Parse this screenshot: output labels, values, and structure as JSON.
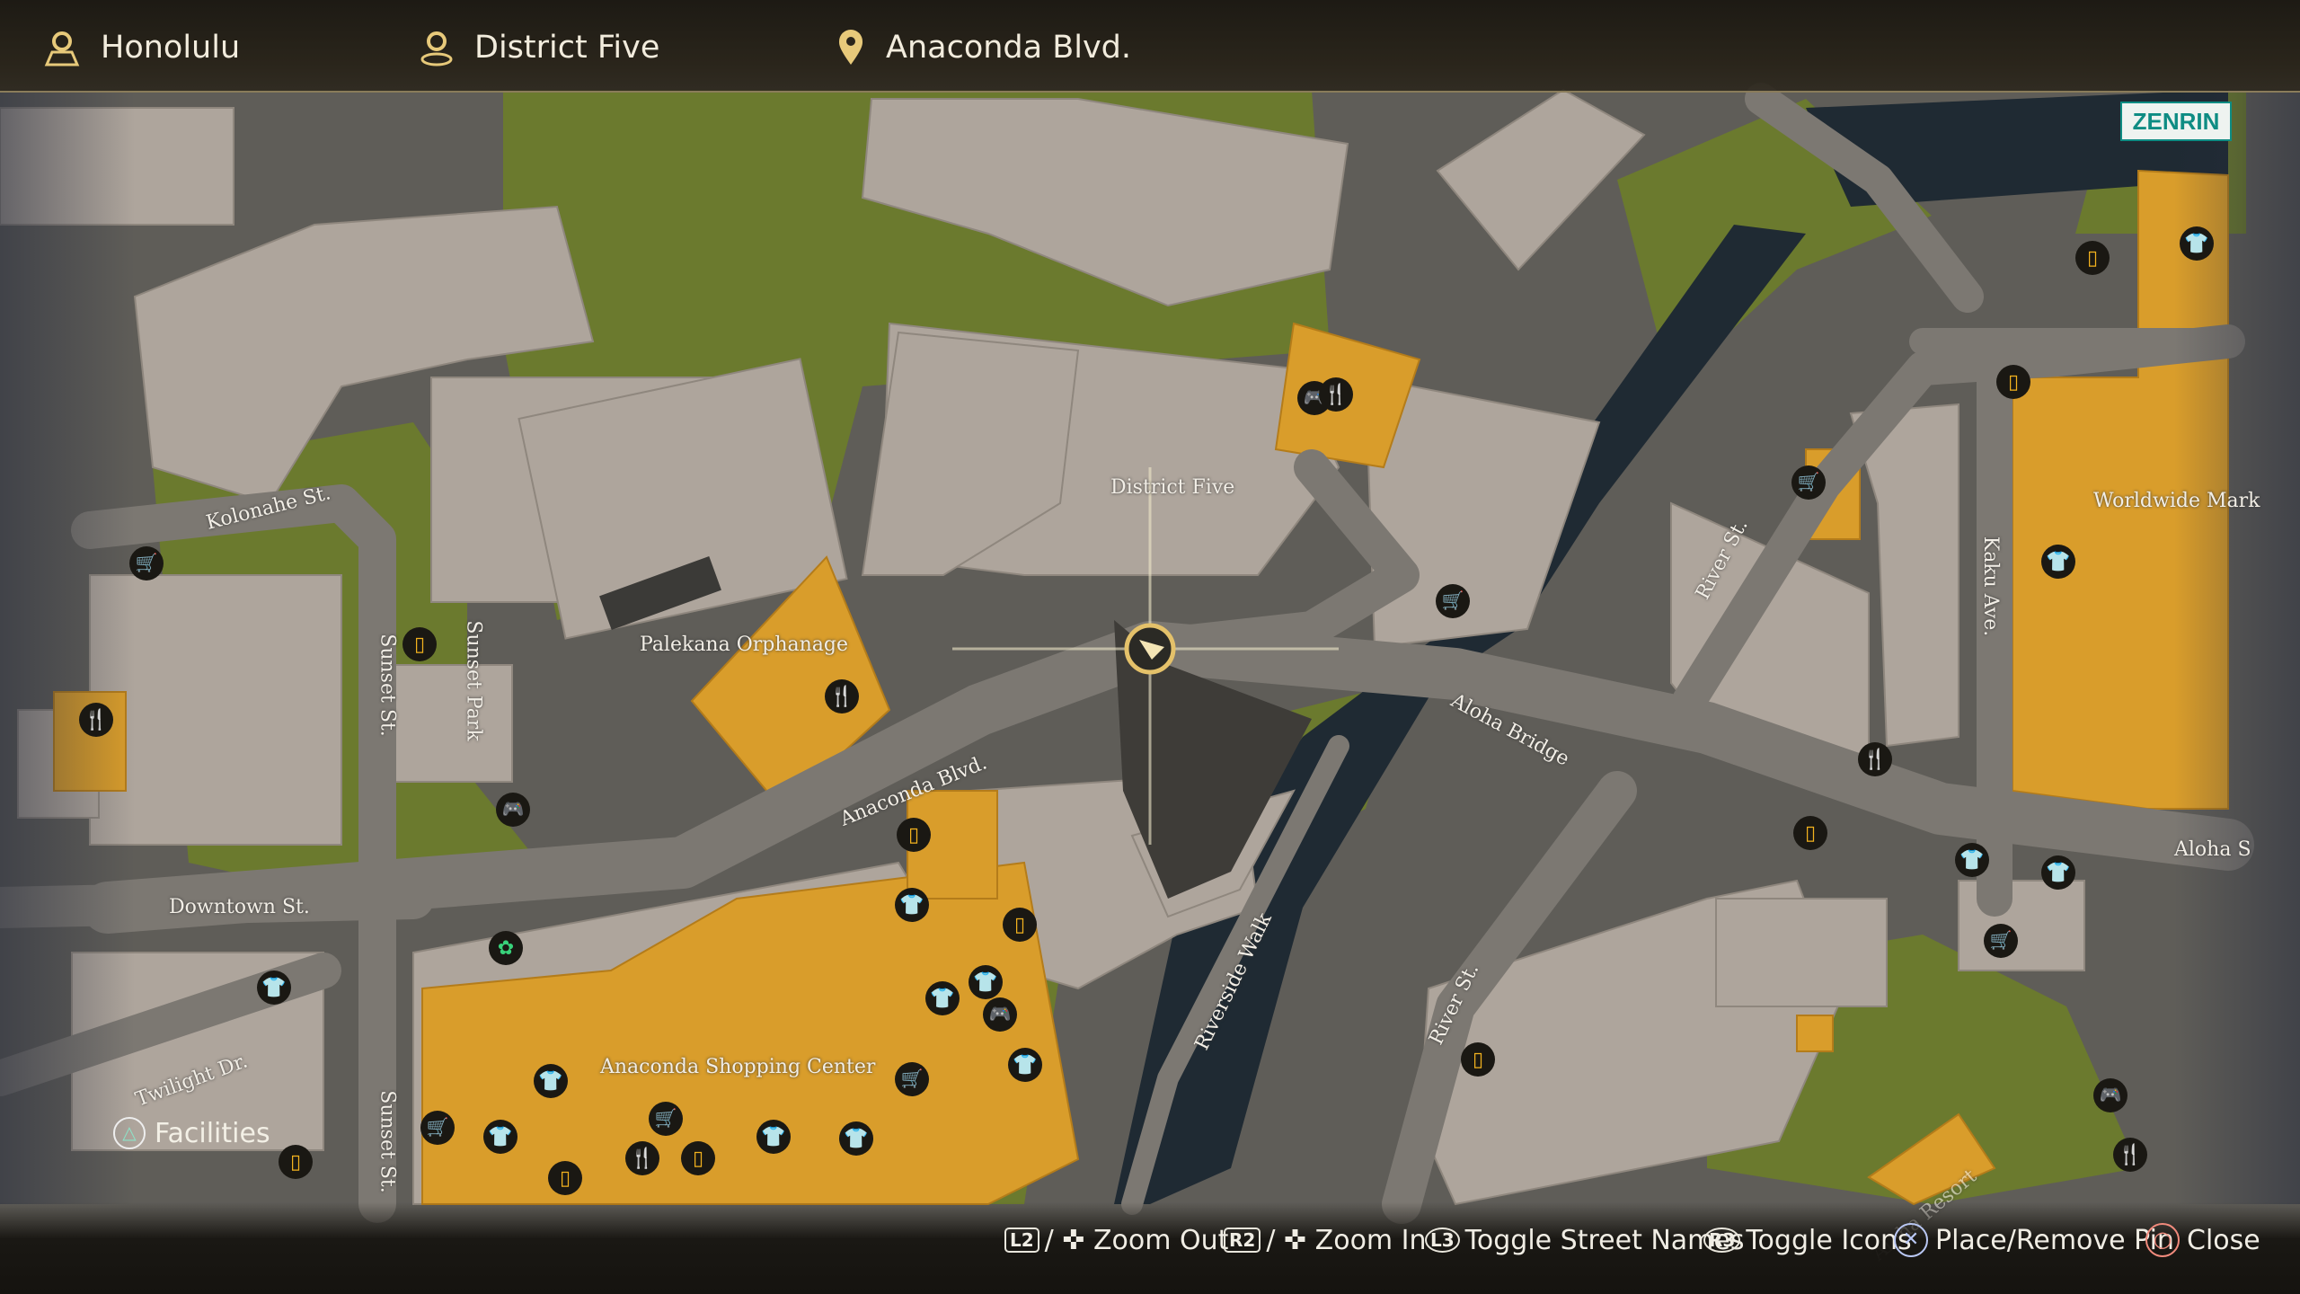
{
  "header": {
    "city": "Honolulu",
    "district": "District Five",
    "street": "Anaconda Blvd."
  },
  "badge": "ZENRIN",
  "map_labels": {
    "district_five": "District Five",
    "palekana": "Palekana Orphanage",
    "anaconda_blvd": "Anaconda Blvd.",
    "anaconda_shopping": "Anaconda Shopping Center",
    "aloha_bridge": "Aloha Bridge",
    "kolonahe": "Kolonahe St.",
    "sunset_st_1": "Sunset St.",
    "sunset_st_2": "Sunset St.",
    "sunset_park": "Sunset Park",
    "downtown": "Downtown St.",
    "twilight": "Twilight Dr.",
    "riverside": "Riverside Walk",
    "river_st_1": "River St.",
    "river_st_2": "River St.",
    "kaku": "Kaku Ave.",
    "worldwide": "Worldwide Mark",
    "aloha_st": "Aloha S",
    "resort": "Aloha Resort"
  },
  "facilities": {
    "button": "△",
    "label": "Facilities"
  },
  "controls": [
    {
      "btn": "L2",
      "label": "Zoom Out"
    },
    {
      "btn": "R2",
      "label": "Zoom In"
    },
    {
      "btn": "L3",
      "label": "Toggle Street Names"
    },
    {
      "btn": "R3",
      "label": "Toggle Icons"
    },
    {
      "btn": "✕",
      "label": "Place/Remove Pin"
    },
    {
      "btn": "○",
      "label": "Close"
    }
  ],
  "colors": {
    "grass": "#6b7a2e",
    "road": "#7c7872",
    "building": "#aea59c",
    "shop": "#d99d2b",
    "water": "#1f2a33",
    "icon_bg": "#1a1813",
    "icon_fg": "#f3b21e"
  }
}
